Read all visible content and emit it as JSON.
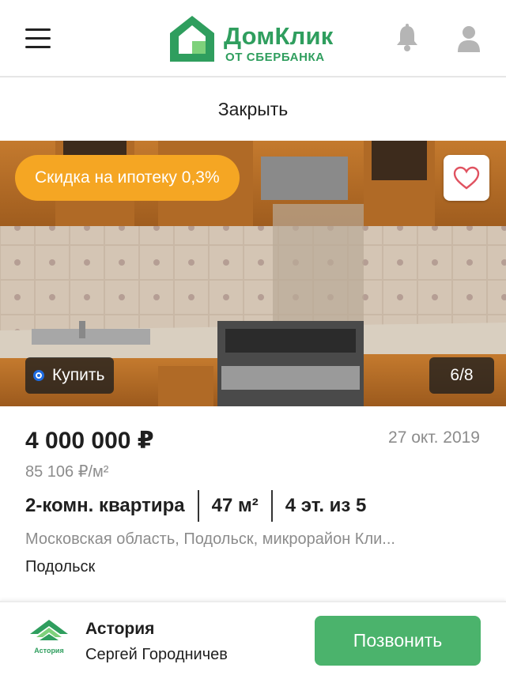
{
  "header": {
    "logo_main": "ДомКлик",
    "logo_sub": "ОТ СБЕРБАНКА",
    "brand_color": "#2f9e5e"
  },
  "close_label": "Закрыть",
  "gallery": {
    "promo_badge": "Скидка на ипотеку 0,3%",
    "deal_type": "Купить",
    "counter": "6/8",
    "promo_color": "#f5a623"
  },
  "listing": {
    "price": "4 000 000 ₽",
    "date": "27 окт. 2019",
    "price_per_m2": "85 106 ₽/м²",
    "type": "2-комн. квартира",
    "area": "47 м²",
    "floor": "4 эт. из 5",
    "address": "Московская область, Подольск, микрорайон Кли...",
    "city": "Подольск"
  },
  "agent": {
    "logo_text": "Астория",
    "agency": "Астория",
    "name": "Сергей Городничев",
    "call_label": "Позвонить",
    "call_color": "#4bb36c"
  }
}
